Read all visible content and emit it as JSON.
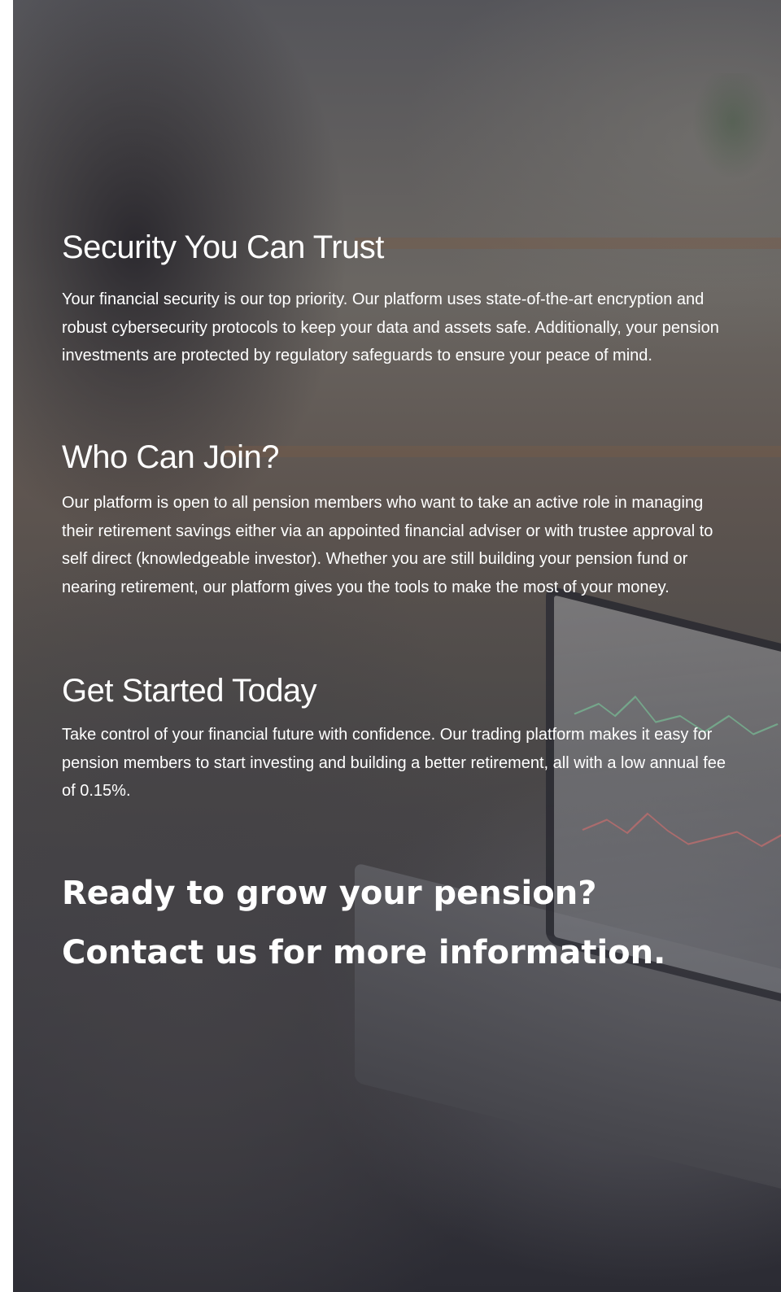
{
  "sections": [
    {
      "title": "Security You Can Trust",
      "body": "Your financial security is our top priority. Our platform uses state-of-the-art encryption and robust cybersecurity protocols to keep your data and assets safe. Additionally, your pension investments are protected by regulatory safeguards to ensure your peace of mind."
    },
    {
      "title": "Who Can Join?",
      "body": "Our platform is open to all pension members who want to take an active role in managing their retirement savings either via an appointed financial adviser or with trustee approval to self direct (knowledgeable investor). Whether you are still building your pension fund or nearing retirement, our platform gives you the tools to make the most of your money."
    },
    {
      "title": "Get Started Today",
      "body": "Take control of your financial future with confidence. Our trading platform makes it easy for pension members to start investing and building a better retirement, all with a low annual fee of 0.15%."
    }
  ],
  "cta": {
    "line1": "Ready to grow your pension?",
    "line2": "Contact us for more information."
  },
  "background": {
    "image": "person-using-laptop-photo"
  }
}
